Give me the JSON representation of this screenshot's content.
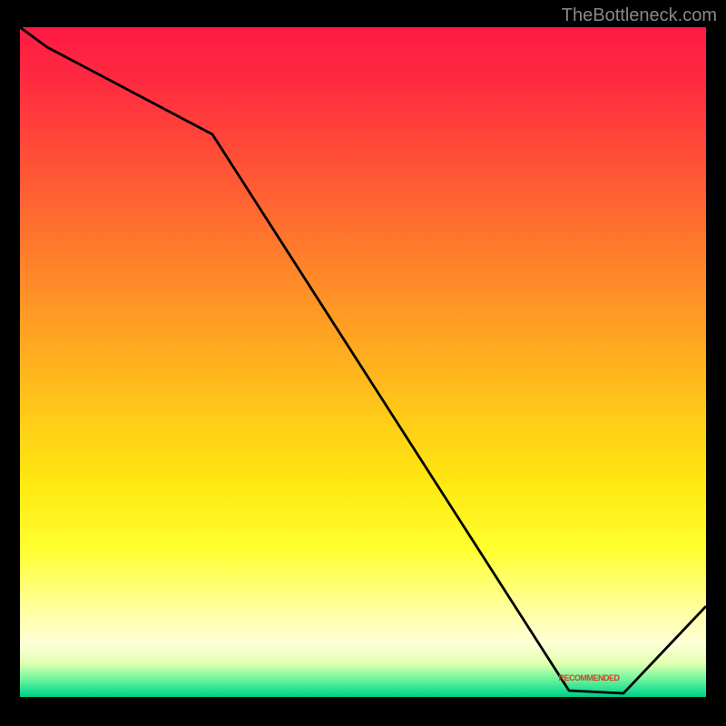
{
  "watermark": "TheBottleneck.com",
  "annotation_label": "RECOMMENDED",
  "chart_data": {
    "type": "line",
    "title": "",
    "xlabel": "",
    "ylabel": "",
    "ylim": [
      0,
      100
    ],
    "xlim": [
      0,
      100
    ],
    "x": [
      0,
      4,
      28,
      80,
      88,
      100
    ],
    "values": [
      100,
      97,
      84,
      1,
      0.5,
      13
    ],
    "note": "Line represents a bottleneck curve descending from top-left, bending near x≈28, reaching a minimum (recommended) around x≈85 near y≈0, then rising towards the right edge. Axes are not labeled in the source image; values are positional estimates on a 0–100 scale."
  }
}
